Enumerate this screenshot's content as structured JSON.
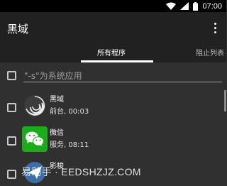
{
  "status_bar": {
    "time": "07:00",
    "icons": [
      "wifi-icon",
      "signal-icon",
      "battery-icon"
    ]
  },
  "app_bar": {
    "title": "黑域",
    "menu_icon": "overflow-menu-icon"
  },
  "tabs": [
    {
      "label": "所有程序",
      "selected": true
    },
    {
      "label": "阻止列表",
      "selected": false
    }
  ],
  "filter": {
    "placeholder": "\"-s\"为系统应用",
    "checked": false
  },
  "apps": [
    {
      "name": "黑域",
      "status": "前台, 00:03",
      "icon": "brevent-swirl-icon",
      "checked": false
    },
    {
      "name": "微信",
      "status": "服务, 08:11",
      "icon": "wechat-icon",
      "checked": false
    },
    {
      "name": "影梭",
      "status": "",
      "icon": "shadowsocks-icon",
      "checked": false
    }
  ],
  "watermark": {
    "text": "易助手 · EEDSHZJZ.COM"
  },
  "colors": {
    "app_bar": "#212121",
    "background": "#303030",
    "wechat_green": "#1aad19",
    "accent": "#ffffff"
  }
}
